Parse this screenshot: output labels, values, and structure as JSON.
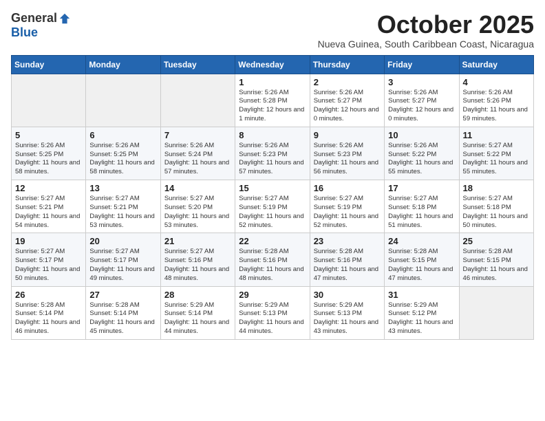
{
  "logo": {
    "general": "General",
    "blue": "Blue"
  },
  "title": "October 2025",
  "subtitle": "Nueva Guinea, South Caribbean Coast, Nicaragua",
  "days_of_week": [
    "Sunday",
    "Monday",
    "Tuesday",
    "Wednesday",
    "Thursday",
    "Friday",
    "Saturday"
  ],
  "weeks": [
    [
      {
        "day": "",
        "info": ""
      },
      {
        "day": "",
        "info": ""
      },
      {
        "day": "",
        "info": ""
      },
      {
        "day": "1",
        "info": "Sunrise: 5:26 AM\nSunset: 5:28 PM\nDaylight: 12 hours and 1 minute."
      },
      {
        "day": "2",
        "info": "Sunrise: 5:26 AM\nSunset: 5:27 PM\nDaylight: 12 hours and 0 minutes."
      },
      {
        "day": "3",
        "info": "Sunrise: 5:26 AM\nSunset: 5:27 PM\nDaylight: 12 hours and 0 minutes."
      },
      {
        "day": "4",
        "info": "Sunrise: 5:26 AM\nSunset: 5:26 PM\nDaylight: 11 hours and 59 minutes."
      }
    ],
    [
      {
        "day": "5",
        "info": "Sunrise: 5:26 AM\nSunset: 5:25 PM\nDaylight: 11 hours and 58 minutes."
      },
      {
        "day": "6",
        "info": "Sunrise: 5:26 AM\nSunset: 5:25 PM\nDaylight: 11 hours and 58 minutes."
      },
      {
        "day": "7",
        "info": "Sunrise: 5:26 AM\nSunset: 5:24 PM\nDaylight: 11 hours and 57 minutes."
      },
      {
        "day": "8",
        "info": "Sunrise: 5:26 AM\nSunset: 5:23 PM\nDaylight: 11 hours and 57 minutes."
      },
      {
        "day": "9",
        "info": "Sunrise: 5:26 AM\nSunset: 5:23 PM\nDaylight: 11 hours and 56 minutes."
      },
      {
        "day": "10",
        "info": "Sunrise: 5:26 AM\nSunset: 5:22 PM\nDaylight: 11 hours and 55 minutes."
      },
      {
        "day": "11",
        "info": "Sunrise: 5:27 AM\nSunset: 5:22 PM\nDaylight: 11 hours and 55 minutes."
      }
    ],
    [
      {
        "day": "12",
        "info": "Sunrise: 5:27 AM\nSunset: 5:21 PM\nDaylight: 11 hours and 54 minutes."
      },
      {
        "day": "13",
        "info": "Sunrise: 5:27 AM\nSunset: 5:21 PM\nDaylight: 11 hours and 53 minutes."
      },
      {
        "day": "14",
        "info": "Sunrise: 5:27 AM\nSunset: 5:20 PM\nDaylight: 11 hours and 53 minutes."
      },
      {
        "day": "15",
        "info": "Sunrise: 5:27 AM\nSunset: 5:19 PM\nDaylight: 11 hours and 52 minutes."
      },
      {
        "day": "16",
        "info": "Sunrise: 5:27 AM\nSunset: 5:19 PM\nDaylight: 11 hours and 52 minutes."
      },
      {
        "day": "17",
        "info": "Sunrise: 5:27 AM\nSunset: 5:18 PM\nDaylight: 11 hours and 51 minutes."
      },
      {
        "day": "18",
        "info": "Sunrise: 5:27 AM\nSunset: 5:18 PM\nDaylight: 11 hours and 50 minutes."
      }
    ],
    [
      {
        "day": "19",
        "info": "Sunrise: 5:27 AM\nSunset: 5:17 PM\nDaylight: 11 hours and 50 minutes."
      },
      {
        "day": "20",
        "info": "Sunrise: 5:27 AM\nSunset: 5:17 PM\nDaylight: 11 hours and 49 minutes."
      },
      {
        "day": "21",
        "info": "Sunrise: 5:27 AM\nSunset: 5:16 PM\nDaylight: 11 hours and 48 minutes."
      },
      {
        "day": "22",
        "info": "Sunrise: 5:28 AM\nSunset: 5:16 PM\nDaylight: 11 hours and 48 minutes."
      },
      {
        "day": "23",
        "info": "Sunrise: 5:28 AM\nSunset: 5:16 PM\nDaylight: 11 hours and 47 minutes."
      },
      {
        "day": "24",
        "info": "Sunrise: 5:28 AM\nSunset: 5:15 PM\nDaylight: 11 hours and 47 minutes."
      },
      {
        "day": "25",
        "info": "Sunrise: 5:28 AM\nSunset: 5:15 PM\nDaylight: 11 hours and 46 minutes."
      }
    ],
    [
      {
        "day": "26",
        "info": "Sunrise: 5:28 AM\nSunset: 5:14 PM\nDaylight: 11 hours and 46 minutes."
      },
      {
        "day": "27",
        "info": "Sunrise: 5:28 AM\nSunset: 5:14 PM\nDaylight: 11 hours and 45 minutes."
      },
      {
        "day": "28",
        "info": "Sunrise: 5:29 AM\nSunset: 5:14 PM\nDaylight: 11 hours and 44 minutes."
      },
      {
        "day": "29",
        "info": "Sunrise: 5:29 AM\nSunset: 5:13 PM\nDaylight: 11 hours and 44 minutes."
      },
      {
        "day": "30",
        "info": "Sunrise: 5:29 AM\nSunset: 5:13 PM\nDaylight: 11 hours and 43 minutes."
      },
      {
        "day": "31",
        "info": "Sunrise: 5:29 AM\nSunset: 5:12 PM\nDaylight: 11 hours and 43 minutes."
      },
      {
        "day": "",
        "info": ""
      }
    ]
  ]
}
